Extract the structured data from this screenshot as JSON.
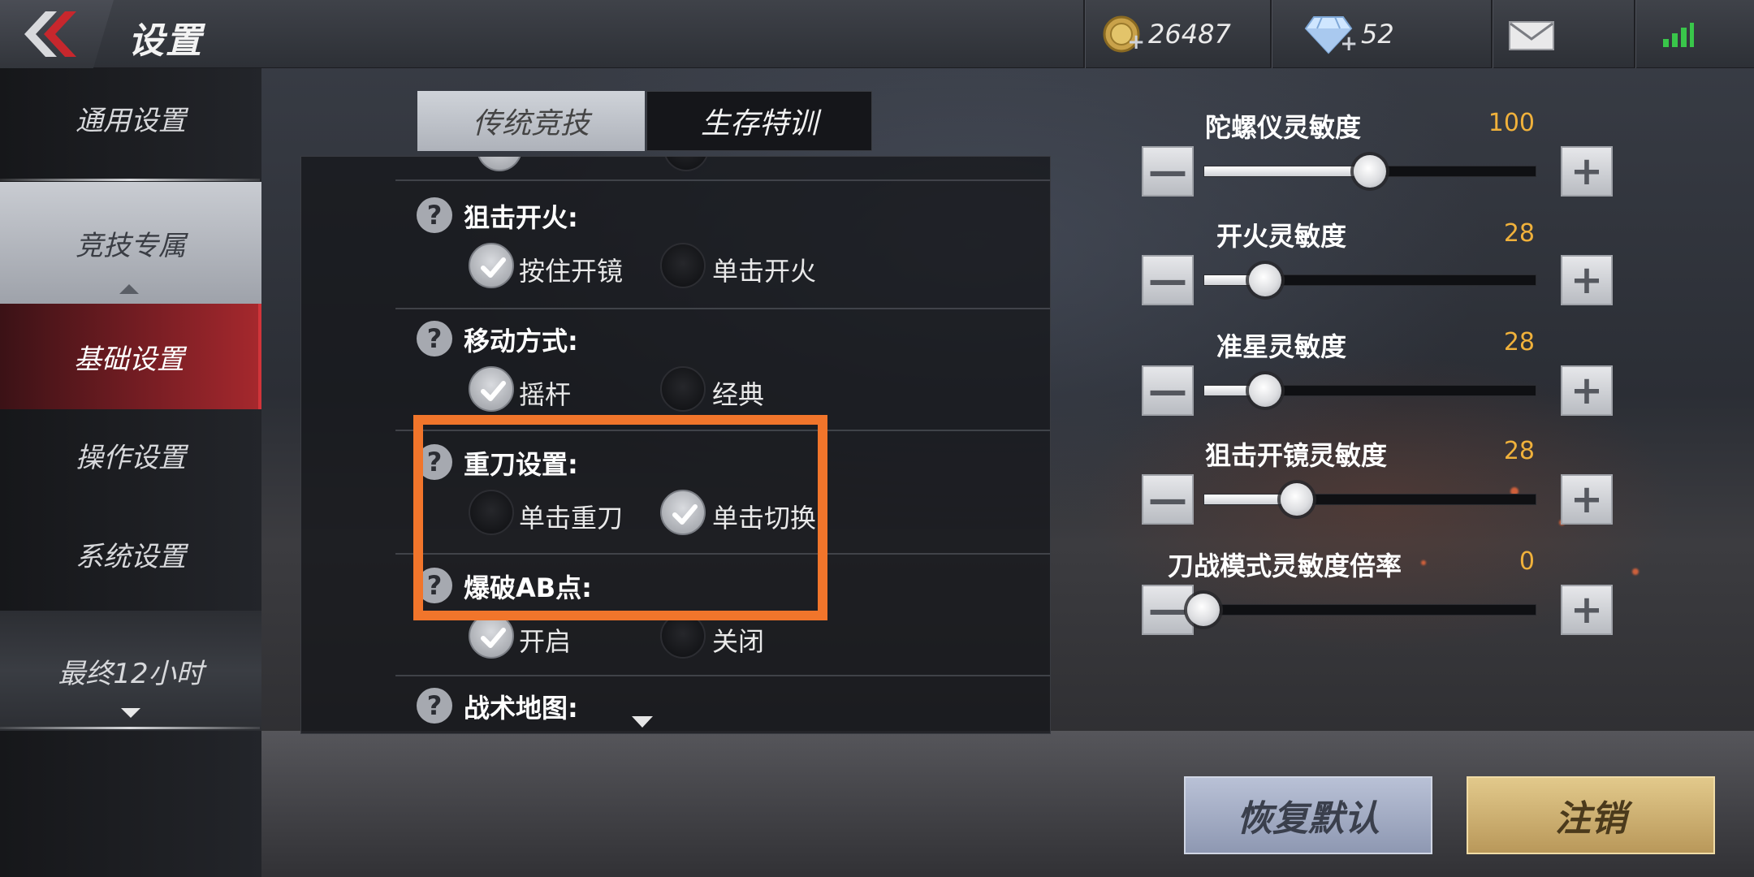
{
  "header": {
    "title": "设置",
    "coins": "26487",
    "diamonds": "52"
  },
  "sidebar": {
    "items": [
      {
        "label": "通用设置"
      },
      {
        "label": "竞技专属"
      },
      {
        "label": "基础设置"
      },
      {
        "label": "操作设置"
      },
      {
        "label": "系统设置"
      },
      {
        "label": "最终12小时"
      }
    ]
  },
  "tabs": [
    {
      "label": "传统竞技",
      "selected": true
    },
    {
      "label": "生存特训",
      "selected": false
    }
  ],
  "settings": [
    {
      "label": "狙击开火:",
      "options": [
        {
          "label": "按住开镜",
          "checked": true
        },
        {
          "label": "单击开火",
          "checked": false
        }
      ]
    },
    {
      "label": "移动方式:",
      "options": [
        {
          "label": "摇杆",
          "checked": true
        },
        {
          "label": "经典",
          "checked": false
        }
      ]
    },
    {
      "label": "重刀设置:",
      "options": [
        {
          "label": "单击重刀",
          "checked": false
        },
        {
          "label": "单击切换",
          "checked": true
        }
      ]
    },
    {
      "label": "爆破AB点:",
      "options": [
        {
          "label": "开启",
          "checked": true
        },
        {
          "label": "关闭",
          "checked": false
        }
      ]
    },
    {
      "label": "战术地图:"
    }
  ],
  "help_glyph": "?",
  "sliders": [
    {
      "label": "陀螺仪灵敏度",
      "value": "100",
      "fraction": 0.5
    },
    {
      "label": "开火灵敏度",
      "value": "28",
      "fraction": 0.185
    },
    {
      "label": "准星灵敏度",
      "value": "28",
      "fraction": 0.185
    },
    {
      "label": "狙击开镜灵敏度",
      "value": "28",
      "fraction": 0.28
    },
    {
      "label": "刀战模式灵敏度倍率",
      "value": "0",
      "fraction": 0.0
    }
  ],
  "buttons": {
    "minus": "—",
    "plus": "+",
    "reset": "恢复默认",
    "logout": "注销"
  },
  "colors": {
    "highlight": "#f1752b",
    "value": "#f0b13b",
    "active_side": "#a5282d"
  }
}
